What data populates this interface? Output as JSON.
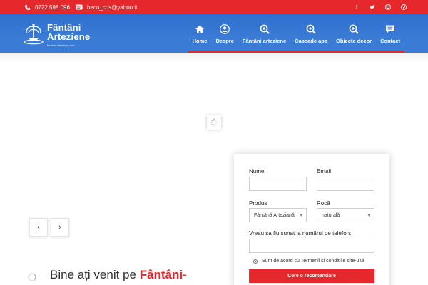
{
  "topbar": {
    "phone": "0722 598 096",
    "email": "becu_cris@yahoo.it",
    "phone_icon": "phone-icon",
    "email_icon": "envelope-icon",
    "social": [
      {
        "name": "facebook-icon",
        "glyph": "f"
      },
      {
        "name": "twitter-icon",
        "glyph": "🐦"
      },
      {
        "name": "instagram-icon",
        "glyph": "◎"
      },
      {
        "name": "pinterest-icon",
        "glyph": "℗"
      }
    ]
  },
  "logo": {
    "line1": "Fântâni",
    "line2": "Arteziene",
    "tagline": "fantani-arteziene.com"
  },
  "nav": [
    {
      "label": "Home",
      "icon": "home-icon",
      "active": true
    },
    {
      "label": "Despre",
      "icon": "user-icon"
    },
    {
      "label": "Fântâni arteziene",
      "icon": "zoom-icon"
    },
    {
      "label": "Cascade apa",
      "icon": "zoom-icon"
    },
    {
      "label": "Obiecte decor",
      "icon": "zoom-icon"
    },
    {
      "label": "Contact",
      "icon": "chat-icon"
    }
  ],
  "slider": {
    "prev_glyph": "‹",
    "next_glyph": "›"
  },
  "welcome": {
    "text": "Bine ați venit pe ",
    "highlight": "Fântâni-"
  },
  "form": {
    "name_label": "Nume",
    "email_label": "Email",
    "name_value": "",
    "email_value": "",
    "product_label": "Produs",
    "product_value": "Fântână Arteziană",
    "rock_label": "Rocă",
    "rock_value": "naturală",
    "phone_label": "Vreau sa fiu sunat la numărul de telefon:",
    "phone_value": "",
    "agree_text": "Sunt de acord cu Termenii si conditiile site-ului",
    "submit_label": "Cere o recomandare"
  },
  "colors": {
    "accent": "#e4282b",
    "header_blue": "#3a7bd5"
  }
}
